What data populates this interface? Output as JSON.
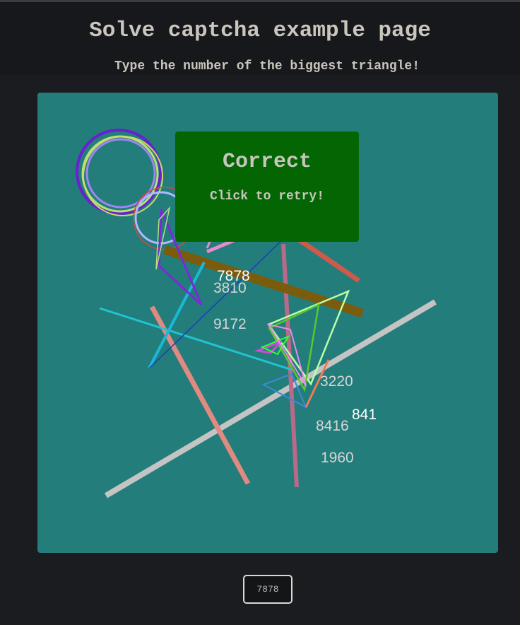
{
  "page": {
    "title": "Solve captcha example page",
    "subtitle": "Type the number of the biggest triangle!"
  },
  "captcha": {
    "background": "#237d7a",
    "numbers": [
      {
        "id": "7878",
        "text": "7878",
        "color": "#ffffff"
      },
      {
        "id": "3810",
        "text": "3810",
        "color": "#d6d6d6"
      },
      {
        "id": "9172",
        "text": "9172",
        "color": "#d6d6d6"
      },
      {
        "id": "3220",
        "text": "3220",
        "color": "#d6d6d6"
      },
      {
        "id": "8416",
        "text": "8416",
        "color": "#d6d6d6"
      },
      {
        "id": "841",
        "text": "841",
        "color": "#ffffff"
      },
      {
        "id": "1960",
        "text": "1960",
        "color": "#d6d6d6"
      }
    ]
  },
  "result": {
    "title": "Correct",
    "subtitle": "Click to retry!",
    "background": "#036603"
  },
  "answer": {
    "value": "7878"
  }
}
